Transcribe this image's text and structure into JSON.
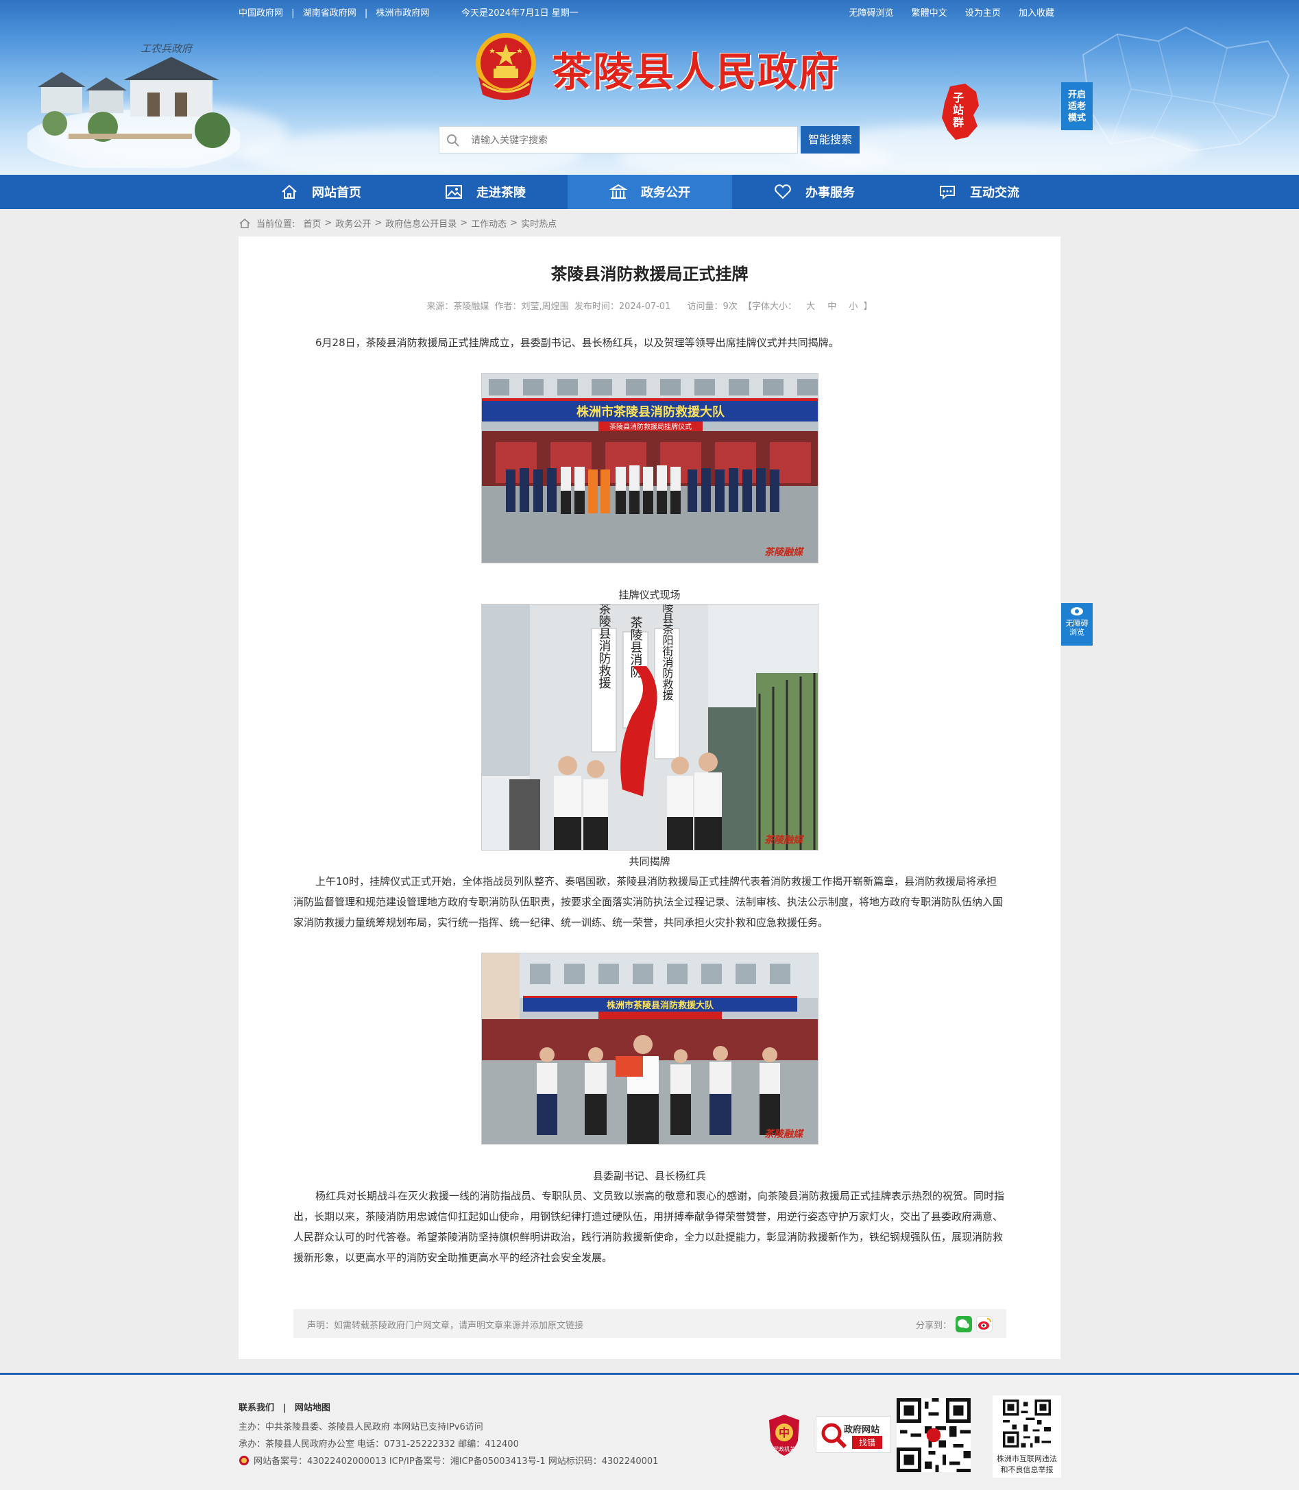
{
  "topbar": {
    "links": [
      "中国政府网",
      "湖南省政府网",
      "株洲市政府网"
    ],
    "divider": "|",
    "date": "今天是2024年7月1日 星期一",
    "right": [
      "无障碍浏览",
      "繁體中文",
      "设为主页",
      "加入收藏"
    ]
  },
  "header": {
    "site_title": "茶陵县人民政府",
    "village_caption": "工农兵政府",
    "search_placeholder": "请输入关键字搜索",
    "search_button": "智能搜索",
    "subsite_label": "子站群",
    "elder_mode": [
      "开启",
      "适老",
      "模式"
    ]
  },
  "nav": [
    {
      "label": "网站首页",
      "icon": "home-icon"
    },
    {
      "label": "走进茶陵",
      "icon": "image-icon"
    },
    {
      "label": "政务公开",
      "icon": "building-icon",
      "active": true
    },
    {
      "label": "办事服务",
      "icon": "heart-icon"
    },
    {
      "label": "互动交流",
      "icon": "chat-icon"
    }
  ],
  "breadcrumb": {
    "prefix": "当前位置:",
    "items": [
      "首页",
      "政务公开",
      "政府信息公开目录",
      "工作动态",
      "实时热点"
    ],
    "sep": ">"
  },
  "article": {
    "title": "茶陵县消防救援局正式挂牌",
    "meta": {
      "source": "来源：茶陵融媒",
      "author": "作者：刘莹,周煌围",
      "date": "发布时间：2024-07-01",
      "views": "访问量：9次",
      "font_size": "【字体大小：",
      "sizes": [
        "大",
        "中",
        "小"
      ],
      "close": "】"
    },
    "paragraphs": [
      "6月28日，茶陵县消防救援局正式挂牌成立，县委副书记、县长杨红兵，以及贺理等领导出席挂牌仪式并共同揭牌。",
      "上午10时，挂牌仪式正式开始，全体指战员列队整齐、奏唱国歌，茶陵县消防救援局正式挂牌代表着消防救援工作揭开崭新篇章，县消防救援局将承担消防监督管理和规范建设管理地方政府专职消防队伍职责，按要求全面落实消防执法全过程记录、法制审核、执法公示制度，将地方政府专职消防队伍纳入国家消防救援力量统筹规划布局，实行统一指挥、统一纪律、统一训练、统一荣誉，共同承担火灾扑救和应急救援任务。",
      "杨红兵对长期战斗在灭火救援一线的消防指战员、专职队员、文员致以崇高的敬意和衷心的感谢，向茶陵县消防救援局正式挂牌表示热烈的祝贺。同时指出，长期以来，茶陵消防用忠诚信仰扛起如山使命，用钢铁纪律打造过硬队伍，用拼搏奉献争得荣誉赞誉，用逆行姿态守护万家灯火，交出了县委政府满意、人民群众认可的时代答卷。希望茶陵消防坚持旗帜鲜明讲政治，践行消防救援新使命，全力以赴提能力，彰显消防救援新作为，铁纪钢规强队伍，展现消防救援新形象，以更高水平的消防安全助推更高水平的经济社会安全发展。"
    ],
    "captions": [
      "挂牌仪式现场",
      "共同揭牌",
      "县委副书记、县长杨红兵"
    ],
    "photo_banner": "株洲市茶陵县消防救援大队",
    "photo_subbanner": "茶陵县消防救援局挂牌仪式",
    "plaques": [
      "茶陵县消防救援",
      "茶陵县消防",
      "茶陵县茶阳街消防救援"
    ],
    "watermark": "茶陵融媒"
  },
  "statement": {
    "text": "声明：如需转载茶陵政府门户网文章，请声明文章来源并添加原文链接",
    "share_label": "分享到：",
    "share_icons": [
      "wechat-icon",
      "weibo-icon"
    ]
  },
  "footer": {
    "links": [
      "联系我们",
      "网站地图"
    ],
    "divider": "|",
    "host": "主办：中共茶陵县委、茶陵县人民政府 本网站已支持IPv6访问",
    "organizer": "承办：茶陵县人民政府办公室 电话：0731-25222332 邮编：412400",
    "record": "网站备案号：43022402000013 ICP/IP备案号：湘ICP备05003413号-1 网站标识码：4302240001",
    "badge_party": "党政机关",
    "badge_error_1": "政府网站",
    "badge_error_2": "找错",
    "report_1": "株洲市互联网违法",
    "report_2": "和不良信息举报"
  },
  "side_access": [
    "无障碍",
    "浏览"
  ],
  "colors": {
    "primary": "#1d62b6",
    "title_red": "#e2231a",
    "active_nav": "#2f7bd1"
  }
}
